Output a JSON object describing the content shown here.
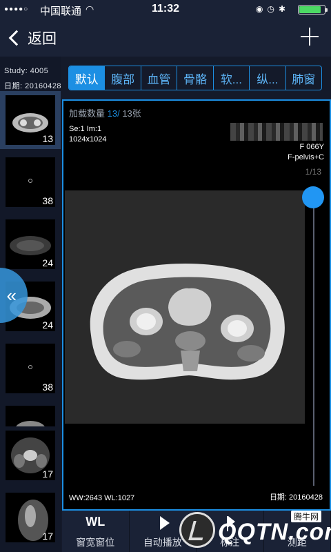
{
  "status_bar": {
    "signal": "●●●●○",
    "carrier": "中国联通",
    "time": "11:32",
    "battery_level": 0.85
  },
  "nav": {
    "back_label": "返回"
  },
  "sidebar": {
    "study": "Study: 4005",
    "date": "日期: 20160428",
    "thumbnails": [
      {
        "count": "13"
      },
      {
        "count": "38"
      },
      {
        "count": "24"
      },
      {
        "count": "24"
      },
      {
        "count": "38"
      },
      {
        "count": ""
      },
      {
        "count": "17"
      },
      {
        "count": "17"
      }
    ]
  },
  "tabs": [
    "默认",
    "腹部",
    "血管",
    "骨骼",
    "软...",
    "纵...",
    "肺窗"
  ],
  "viewer": {
    "loading_prefix": "加载数量 ",
    "loading_current": "13/",
    "loading_total": " 13张",
    "series": "Se:1  Im:1",
    "resolution": "1024x1024",
    "patient_sex_age": "F  066Y",
    "protocol": "F-pelvis+C",
    "page": "1/13",
    "ww_wl": "WW:2643  WL:1027",
    "date": "日期: 20160428"
  },
  "toolbar": {
    "wl_glyph": "WL",
    "wl_label": "窗宽窗位",
    "autoplay_label": "自动播放",
    "annotate_label": "标注",
    "measure_label": "测距"
  },
  "watermark": {
    "text": "QQTN.com",
    "tag": "腾牛网"
  },
  "colors": {
    "accent": "#1c8fe3",
    "background": "#141a2a",
    "battery": "#4cd964"
  }
}
